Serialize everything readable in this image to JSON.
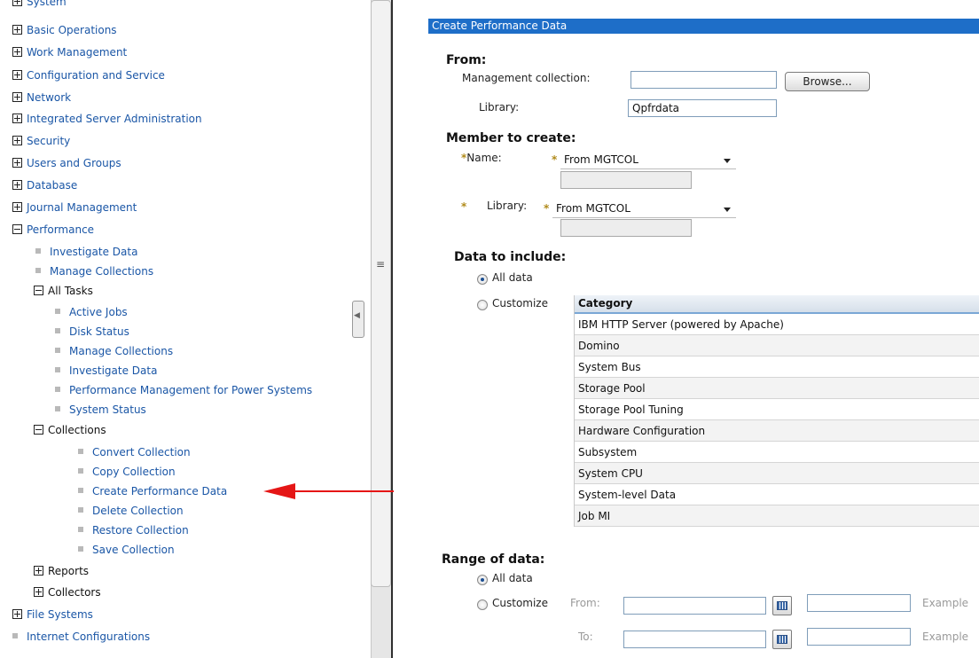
{
  "nav": {
    "items": [
      {
        "label": "System",
        "kind": "plus",
        "color": "link"
      },
      {
        "label": "Basic Operations",
        "kind": "plus",
        "color": "link"
      },
      {
        "label": "Work Management",
        "kind": "plus",
        "color": "link"
      },
      {
        "label": "Configuration and Service",
        "kind": "plus",
        "color": "link"
      },
      {
        "label": "Network",
        "kind": "plus",
        "color": "link"
      },
      {
        "label": "Integrated Server Administration",
        "kind": "plus",
        "color": "link"
      },
      {
        "label": "Security",
        "kind": "plus",
        "color": "link"
      },
      {
        "label": "Users and Groups",
        "kind": "plus",
        "color": "link"
      },
      {
        "label": "Database",
        "kind": "plus",
        "color": "link"
      },
      {
        "label": "Journal Management",
        "kind": "plus",
        "color": "link"
      },
      {
        "label": "Performance",
        "kind": "minus",
        "color": "link"
      },
      {
        "label": "Investigate Data",
        "kind": "leaf",
        "color": "link"
      },
      {
        "label": "Manage Collections",
        "kind": "leaf",
        "color": "link"
      },
      {
        "label": "All Tasks",
        "kind": "minus",
        "color": "black"
      },
      {
        "label": "Active Jobs",
        "kind": "leaf",
        "color": "link"
      },
      {
        "label": "Disk Status",
        "kind": "leaf",
        "color": "link"
      },
      {
        "label": "Manage Collections",
        "kind": "leaf",
        "color": "link"
      },
      {
        "label": "Investigate Data",
        "kind": "leaf",
        "color": "link"
      },
      {
        "label": "Performance Management for Power Systems",
        "kind": "leaf",
        "color": "link"
      },
      {
        "label": "System Status",
        "kind": "leaf",
        "color": "link"
      },
      {
        "label": "Collections",
        "kind": "minus",
        "color": "black"
      },
      {
        "label": "Convert Collection",
        "kind": "leaf",
        "color": "link"
      },
      {
        "label": "Copy Collection",
        "kind": "leaf",
        "color": "link"
      },
      {
        "label": "Create Performance Data",
        "kind": "leaf",
        "color": "link"
      },
      {
        "label": "Delete Collection",
        "kind": "leaf",
        "color": "link"
      },
      {
        "label": "Restore Collection",
        "kind": "leaf",
        "color": "link"
      },
      {
        "label": "Save Collection",
        "kind": "leaf",
        "color": "link"
      },
      {
        "label": "Reports",
        "kind": "plus",
        "color": "black"
      },
      {
        "label": "Collectors",
        "kind": "plus",
        "color": "black"
      },
      {
        "label": "File Systems",
        "kind": "plus",
        "color": "link"
      },
      {
        "label": "Internet Configurations",
        "kind": "leaf",
        "color": "link"
      }
    ]
  },
  "panel": {
    "title": "Create Performance Data",
    "from": {
      "heading": "From:",
      "mgmt_label": "Management collection:",
      "mgmt_value": "",
      "browse_label": "Browse...",
      "library_label": "Library:",
      "library_value": "Qpfrdata"
    },
    "member": {
      "heading": "Member to create:",
      "name_label": "Name:",
      "name_select": "From MGTCOL",
      "library_label": "Library:",
      "library_select": "From MGTCOL",
      "required_marker": "*"
    },
    "data_include": {
      "heading": "Data to include:",
      "all_label": "All data",
      "customize_label": "Customize",
      "category_header": "Category",
      "categories": [
        "IBM HTTP Server (powered by Apache)",
        "Domino",
        "System Bus",
        "Storage Pool",
        "Storage Pool Tuning",
        "Hardware Configuration",
        "Subsystem",
        "System CPU",
        "System-level Data",
        "Job MI"
      ]
    },
    "range": {
      "heading": "Range of data:",
      "all_label": "All data",
      "customize_label": "Customize",
      "from_label": "From:",
      "to_label": "To:",
      "example_label": "Example"
    }
  },
  "colors": {
    "accent": "#1e6ec8",
    "link": "#1a56a6",
    "arrow": "#e51616",
    "required": "#b08a1a"
  }
}
